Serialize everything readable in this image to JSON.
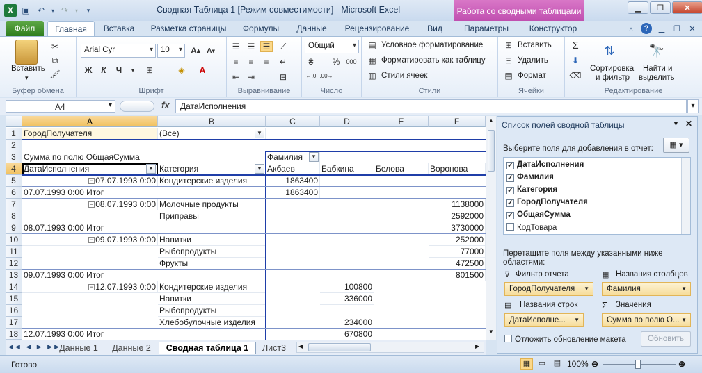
{
  "window": {
    "title": "Сводная Таблица 1  [Режим совместимости]  -  Microsoft Excel",
    "context_tab": "Работа со сводными таблицами"
  },
  "ribbon_tabs": [
    "Файл",
    "Главная",
    "Вставка",
    "Разметка страницы",
    "Формулы",
    "Данные",
    "Рецензирование",
    "Вид",
    "Параметры",
    "Конструктор"
  ],
  "ribbon": {
    "clipboard": {
      "paste": "Вставить",
      "label": "Буфер обмена"
    },
    "font": {
      "name": "Arial Cyr",
      "size": "10",
      "label": "Шрифт"
    },
    "alignment": {
      "label": "Выравнивание"
    },
    "number": {
      "format": "Общий",
      "label": "Число"
    },
    "styles": {
      "conditional": "Условное форматирование",
      "as_table": "Форматировать как таблицу",
      "cell_styles": "Стили ячеек",
      "label": "Стили"
    },
    "cells": {
      "insert": "Вставить",
      "delete": "Удалить",
      "format": "Формат",
      "label": "Ячейки"
    },
    "editing": {
      "sort1": "Сортировка",
      "sort2": "и фильтр",
      "find1": "Найти и",
      "find2": "выделить",
      "label": "Редактирование"
    }
  },
  "formula_bar": {
    "name_box": "A4",
    "fx": "fx",
    "value": "ДатаИсполнения"
  },
  "columns": [
    "A",
    "B",
    "C",
    "D",
    "E",
    "F"
  ],
  "rows": [
    "1",
    "2",
    "3",
    "4",
    "5",
    "6",
    "7",
    "8",
    "9",
    "10",
    "11",
    "12",
    "13",
    "14",
    "15",
    "16",
    "17",
    "18"
  ],
  "cells": {
    "r1": {
      "a": "ГородПолучателя",
      "b": "(Все)"
    },
    "r3": {
      "a": "Сумма по полю ОбщаяСумма",
      "c": "Фамилия"
    },
    "r4": {
      "a": "ДатаИсполнения",
      "b": "Категория",
      "c": "Акбаев",
      "d": "Бабкина",
      "e": "Белова",
      "f": "Воронова"
    },
    "r5": {
      "a": "07.07.1993 0:00",
      "b": "Кондитерские изделия",
      "c": "1863400"
    },
    "r6": {
      "a": "07.07.1993 0:00 Итог",
      "c": "1863400"
    },
    "r7": {
      "a": "08.07.1993 0:00",
      "b": "Молочные продукты",
      "f": "1138000"
    },
    "r8": {
      "b": "Приправы",
      "f": "2592000"
    },
    "r9": {
      "a": "08.07.1993 0:00 Итог",
      "f": "3730000"
    },
    "r10": {
      "a": "09.07.1993 0:00",
      "b": "Напитки",
      "f": "252000"
    },
    "r11": {
      "b": "Рыбопродукты",
      "f": "77000"
    },
    "r12": {
      "b": "Фрукты",
      "f": "472500"
    },
    "r13": {
      "a": "09.07.1993 0:00 Итог",
      "f": "801500"
    },
    "r14": {
      "a": "12.07.1993 0:00",
      "b": "Кондитерские изделия",
      "d": "100800"
    },
    "r15": {
      "b": "Напитки",
      "d": "336000"
    },
    "r16": {
      "b": "Рыбопродукты"
    },
    "r17": {
      "b": "Хлебобулочные изделия",
      "d": "234000"
    },
    "r18": {
      "a": "12.07.1993 0:00 Итог",
      "d": "670800"
    }
  },
  "sheet_tabs": [
    "Данные 1",
    "Данные 2",
    "Сводная таблица 1",
    "Лист3"
  ],
  "status": {
    "ready": "Готово",
    "zoom": "100%"
  },
  "pivot_pane": {
    "title": "Список полей сводной таблицы",
    "choose": "Выберите поля для добавления в отчет:",
    "fields": [
      {
        "label": "ДатаИсполнения",
        "checked": true
      },
      {
        "label": "Фамилия",
        "checked": true
      },
      {
        "label": "Категория",
        "checked": true
      },
      {
        "label": "ГородПолучателя",
        "checked": true
      },
      {
        "label": "ОбщаяСумма",
        "checked": true
      },
      {
        "label": "КодТовара",
        "checked": false
      }
    ],
    "drag_hint1": "Перетащите поля между указанными ниже",
    "drag_hint2": "областями:",
    "report_filter": "Фильтр отчета",
    "column_labels": "Названия столбцов",
    "row_labels": "Названия строк",
    "values": "Значения",
    "filter_field": "ГородПолучателя",
    "column_field": "Фамилия",
    "row_field": "ДатаИсполне...",
    "value_field": "Сумма по полю О...",
    "defer": "Отложить обновление макета",
    "update": "Обновить"
  }
}
